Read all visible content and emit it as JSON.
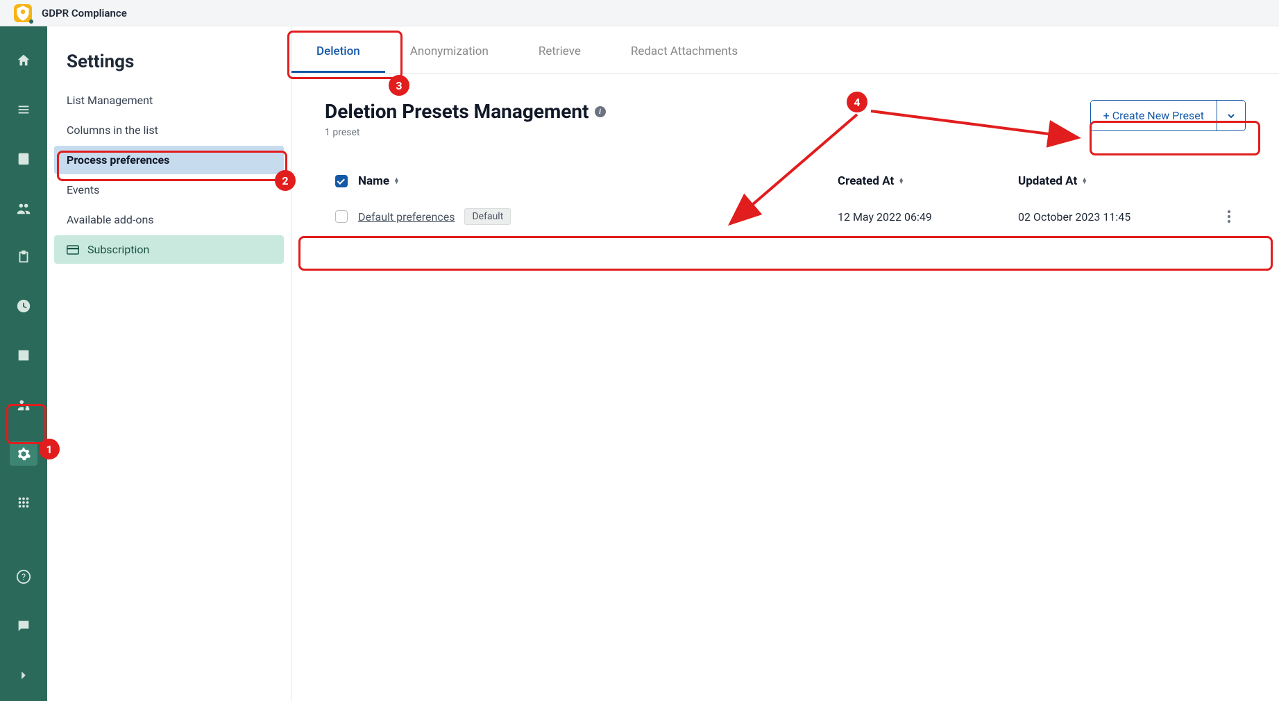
{
  "app": {
    "title": "GDPR Compliance"
  },
  "iconrail": {
    "items": [
      {
        "name": "home-icon"
      },
      {
        "name": "list-icon"
      },
      {
        "name": "notebook-icon"
      },
      {
        "name": "people-icon"
      },
      {
        "name": "clipboard-icon"
      },
      {
        "name": "clock-icon"
      },
      {
        "name": "chart-icon"
      },
      {
        "name": "user-lock-icon"
      },
      {
        "name": "gear-icon",
        "active": true
      },
      {
        "name": "apps-grid-icon"
      }
    ],
    "footer_items": [
      {
        "name": "help-icon"
      },
      {
        "name": "comment-icon"
      },
      {
        "name": "chevron-right-icon"
      }
    ]
  },
  "settings": {
    "title": "Settings",
    "items": [
      {
        "label": "List Management"
      },
      {
        "label": "Columns in the list"
      },
      {
        "label": "Process preferences",
        "active": true
      },
      {
        "label": "Events"
      },
      {
        "label": "Available add-ons"
      },
      {
        "label": "Subscription",
        "highlight": true,
        "icon": "card-icon"
      }
    ]
  },
  "tabs": [
    {
      "label": "Deletion",
      "active": true
    },
    {
      "label": "Anonymization"
    },
    {
      "label": "Retrieve"
    },
    {
      "label": "Redact Attachments"
    }
  ],
  "page": {
    "title": "Deletion Presets Management",
    "count_label": "1 preset",
    "create_button": "+ Create New Preset"
  },
  "table": {
    "columns": {
      "name": "Name",
      "created": "Created At",
      "updated": "Updated At"
    },
    "rows": [
      {
        "name": "Default preferences",
        "badge": "Default",
        "created": "12 May 2022 06:49",
        "updated": "02 October 2023 11:45"
      }
    ]
  },
  "annotations": {
    "badge1": "1",
    "badge2": "2",
    "badge3": "3",
    "badge4": "4"
  }
}
